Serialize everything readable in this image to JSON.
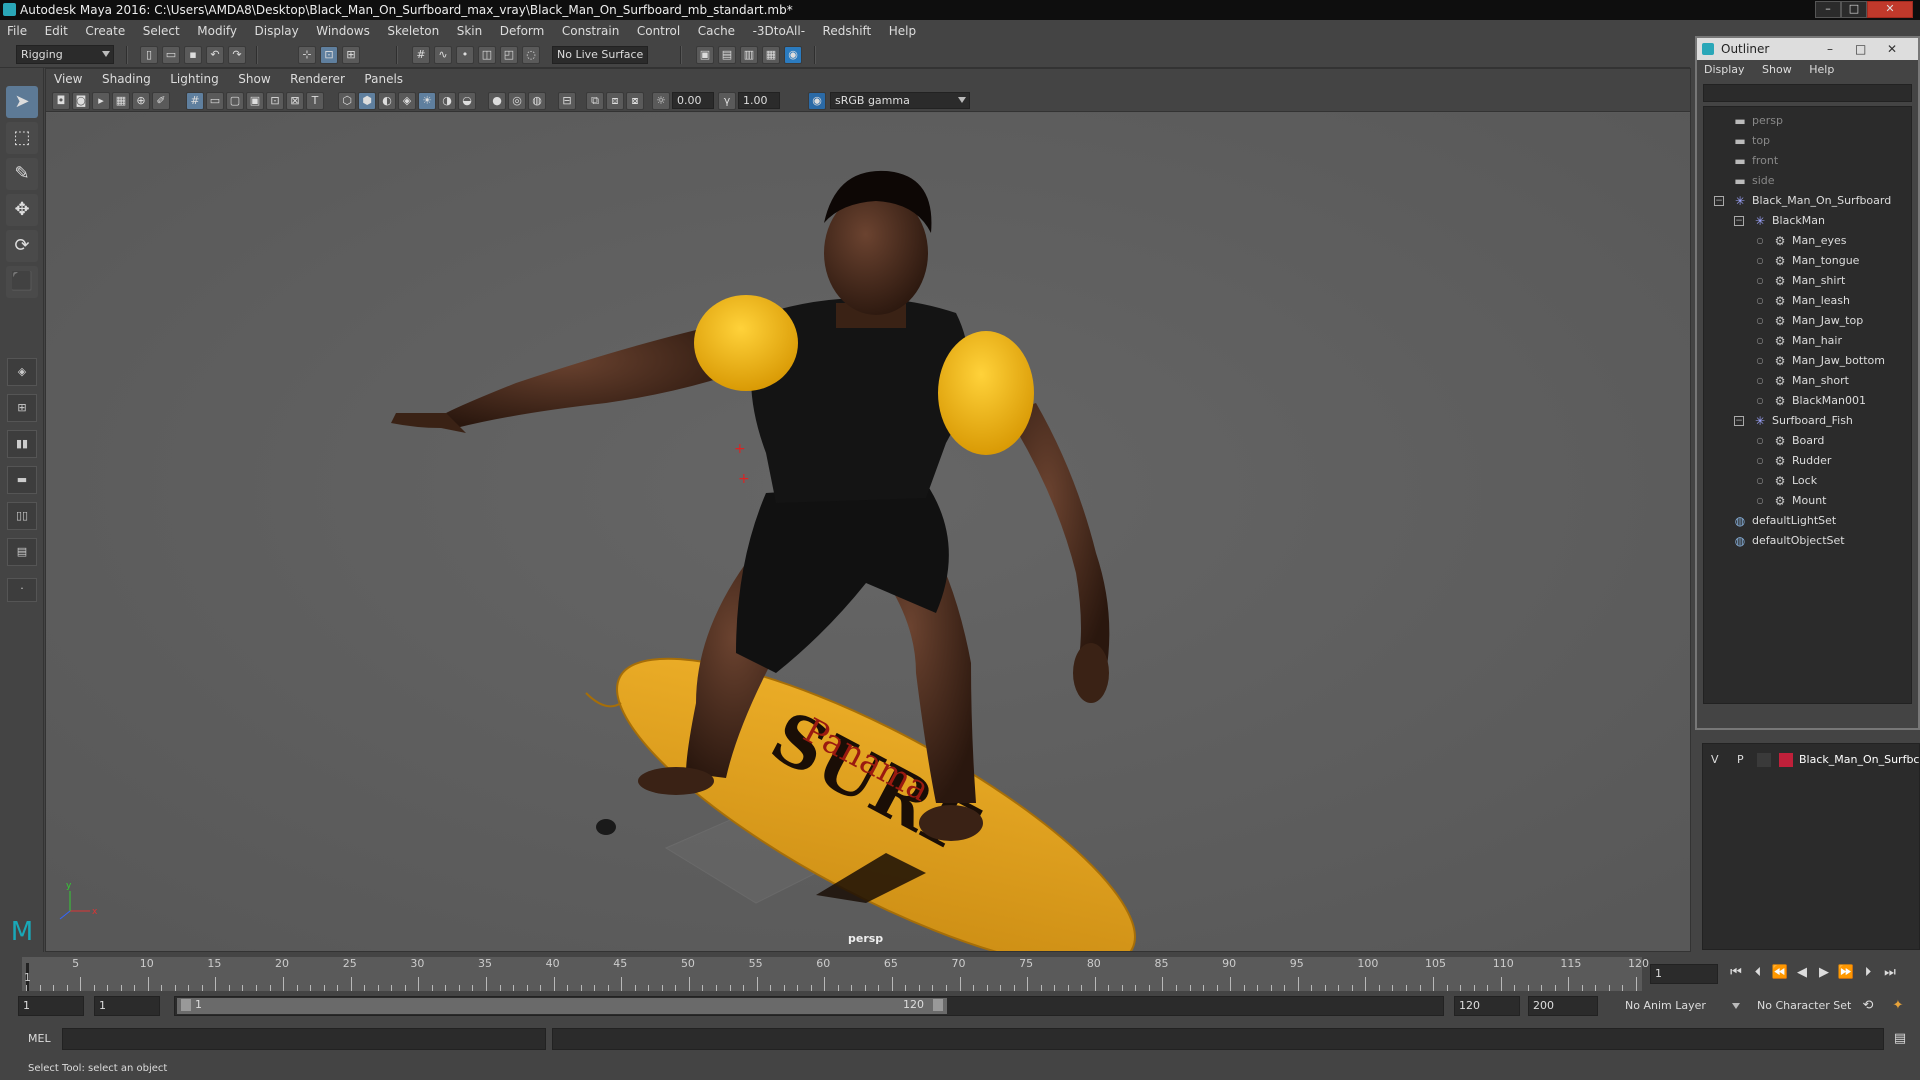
{
  "title_bar": {
    "text": "Autodesk Maya 2016: C:\\Users\\AMDA8\\Desktop\\Black_Man_On_Surfboard_max_vray\\Black_Man_On_Surfboard_mb_standart.mb*",
    "minimize": "–",
    "maximize": "□",
    "close": "✕"
  },
  "menubar": [
    "File",
    "Edit",
    "Create",
    "Select",
    "Modify",
    "Display",
    "Windows",
    "Skeleton",
    "Skin",
    "Deform",
    "Constrain",
    "Control",
    "Cache",
    "-3DtoAll-",
    "Redshift",
    "Help"
  ],
  "shelf": {
    "menuset": "Rigging",
    "live_surface": "No Live Surface"
  },
  "panel_menu": [
    "View",
    "Shading",
    "Lighting",
    "Show",
    "Renderer",
    "Panels"
  ],
  "panel_toolbar": {
    "exposure": "0.00",
    "gamma": "1.00",
    "color_space": "sRGB gamma"
  },
  "viewport": {
    "camera_label": "persp",
    "board_text": "Panama"
  },
  "outliner": {
    "title": "Outliner",
    "menu": [
      "Display",
      "Show",
      "Help"
    ],
    "items": [
      {
        "label": "persp",
        "depth": 0,
        "kind": "camera",
        "dim": true
      },
      {
        "label": "top",
        "depth": 0,
        "kind": "camera",
        "dim": true
      },
      {
        "label": "front",
        "depth": 0,
        "kind": "camera",
        "dim": true
      },
      {
        "label": "side",
        "depth": 0,
        "kind": "camera",
        "dim": true
      },
      {
        "label": "Black_Man_On_Surfboard",
        "depth": 0,
        "kind": "group",
        "expanded": true
      },
      {
        "label": "BlackMan",
        "depth": 1,
        "kind": "group",
        "expanded": true
      },
      {
        "label": "Man_eyes",
        "depth": 2,
        "kind": "mesh"
      },
      {
        "label": "Man_tongue",
        "depth": 2,
        "kind": "mesh"
      },
      {
        "label": "Man_shirt",
        "depth": 2,
        "kind": "mesh"
      },
      {
        "label": "Man_leash",
        "depth": 2,
        "kind": "mesh"
      },
      {
        "label": "Man_Jaw_top",
        "depth": 2,
        "kind": "mesh"
      },
      {
        "label": "Man_hair",
        "depth": 2,
        "kind": "mesh"
      },
      {
        "label": "Man_Jaw_bottom",
        "depth": 2,
        "kind": "mesh"
      },
      {
        "label": "Man_short",
        "depth": 2,
        "kind": "mesh"
      },
      {
        "label": "BlackMan001",
        "depth": 2,
        "kind": "mesh"
      },
      {
        "label": "Surfboard_Fish",
        "depth": 1,
        "kind": "group",
        "expanded": true
      },
      {
        "label": "Board",
        "depth": 2,
        "kind": "mesh"
      },
      {
        "label": "Rudder",
        "depth": 2,
        "kind": "mesh"
      },
      {
        "label": "Lock",
        "depth": 2,
        "kind": "mesh"
      },
      {
        "label": "Mount",
        "depth": 2,
        "kind": "mesh"
      },
      {
        "label": "defaultLightSet",
        "depth": 0,
        "kind": "set"
      },
      {
        "label": "defaultObjectSet",
        "depth": 0,
        "kind": "set"
      }
    ]
  },
  "layer_editor": {
    "visible": "V",
    "playback": "P",
    "layer_name": "Black_Man_On_Surfbc",
    "layer_color": "#c0203a"
  },
  "timeline": {
    "ticks": [
      "5",
      "10",
      "15",
      "20",
      "25",
      "30",
      "35",
      "40",
      "45",
      "50",
      "55",
      "60",
      "65",
      "70",
      "75",
      "80",
      "85",
      "90",
      "95",
      "100",
      "105",
      "110",
      "115",
      "120"
    ],
    "start_tick_label": "1",
    "current_frame": "1"
  },
  "range": {
    "start": "1",
    "playback_start": "1",
    "slider_start": "1",
    "slider_end": "120",
    "playback_end": "120",
    "end": "200",
    "anim_layer": "No Anim Layer",
    "character_set": "No Character Set"
  },
  "command_line": {
    "language": "MEL"
  },
  "status_line": {
    "text": "Select Tool: select an object"
  },
  "colors": {
    "accent": "#5d7a96",
    "shirt_yellow": "#f2b70f",
    "board_yellow": "#e9a820",
    "skin": "#3b2417"
  }
}
